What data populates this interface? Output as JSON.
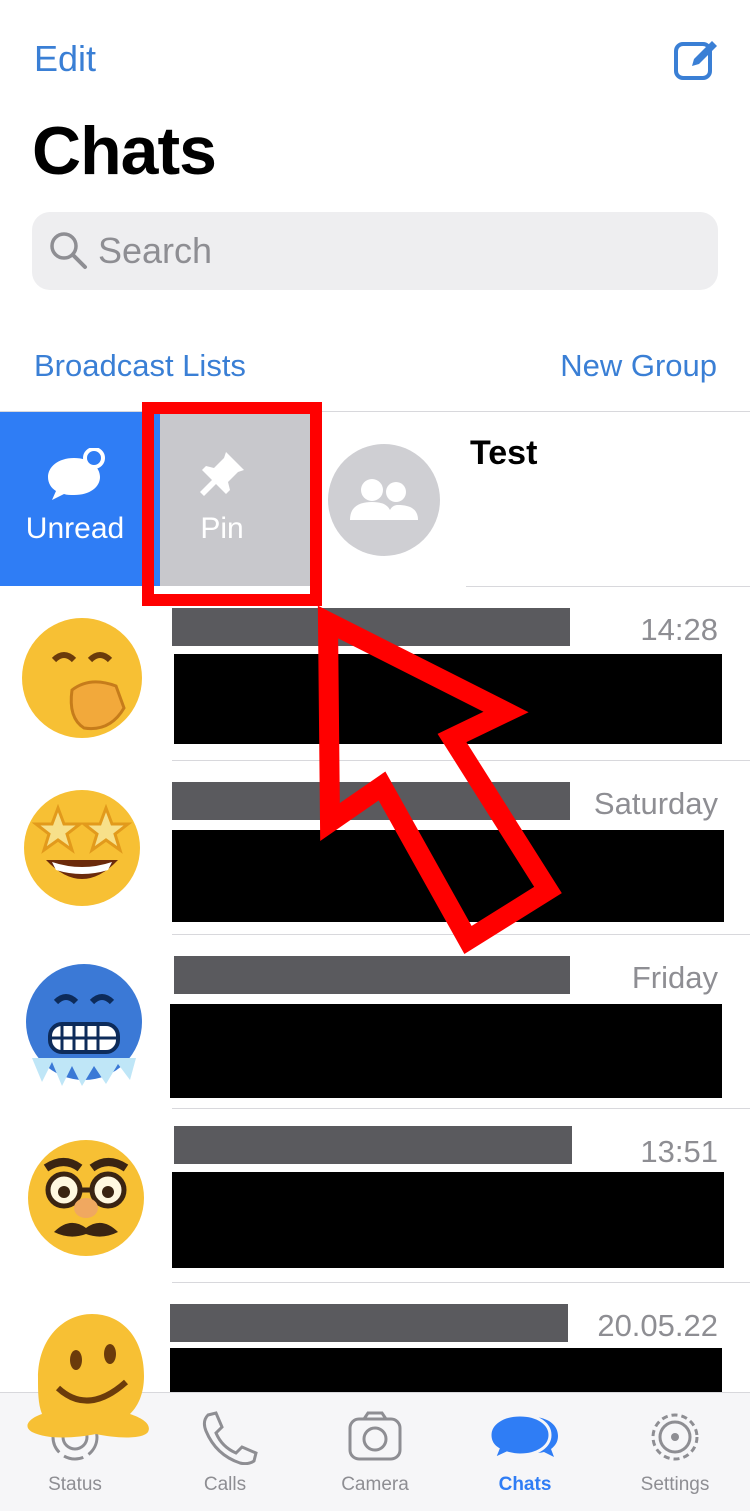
{
  "header": {
    "edit_label": "Edit",
    "title": "Chats",
    "search_placeholder": "Search"
  },
  "links": {
    "broadcast_lists": "Broadcast Lists",
    "new_group": "New Group"
  },
  "swipe_actions": {
    "unread_label": "Unread",
    "pin_label": "Pin"
  },
  "swiped_chat": {
    "name": "Test"
  },
  "chats": [
    {
      "time": "14:28",
      "avatar": "hand-over-mouth-emoji"
    },
    {
      "time": "Saturday",
      "avatar": "star-struck-emoji"
    },
    {
      "time": "Friday",
      "avatar": "cold-face-emoji"
    },
    {
      "time": "13:51",
      "avatar": "disguised-face-emoji"
    },
    {
      "time": "20.05.22",
      "avatar": "melting-face-emoji"
    }
  ],
  "tabs": [
    {
      "label": "Status",
      "icon": "status-icon",
      "active": false
    },
    {
      "label": "Calls",
      "icon": "phone-icon",
      "active": false
    },
    {
      "label": "Camera",
      "icon": "camera-icon",
      "active": false
    },
    {
      "label": "Chats",
      "icon": "chat-bubbles-icon",
      "active": true
    },
    {
      "label": "Settings",
      "icon": "gear-icon",
      "active": false
    }
  ],
  "colors": {
    "accent": "#3a7fd5",
    "unread_action": "#2f7df5",
    "pin_action": "#c8c8cc",
    "highlight": "#ff0000"
  }
}
